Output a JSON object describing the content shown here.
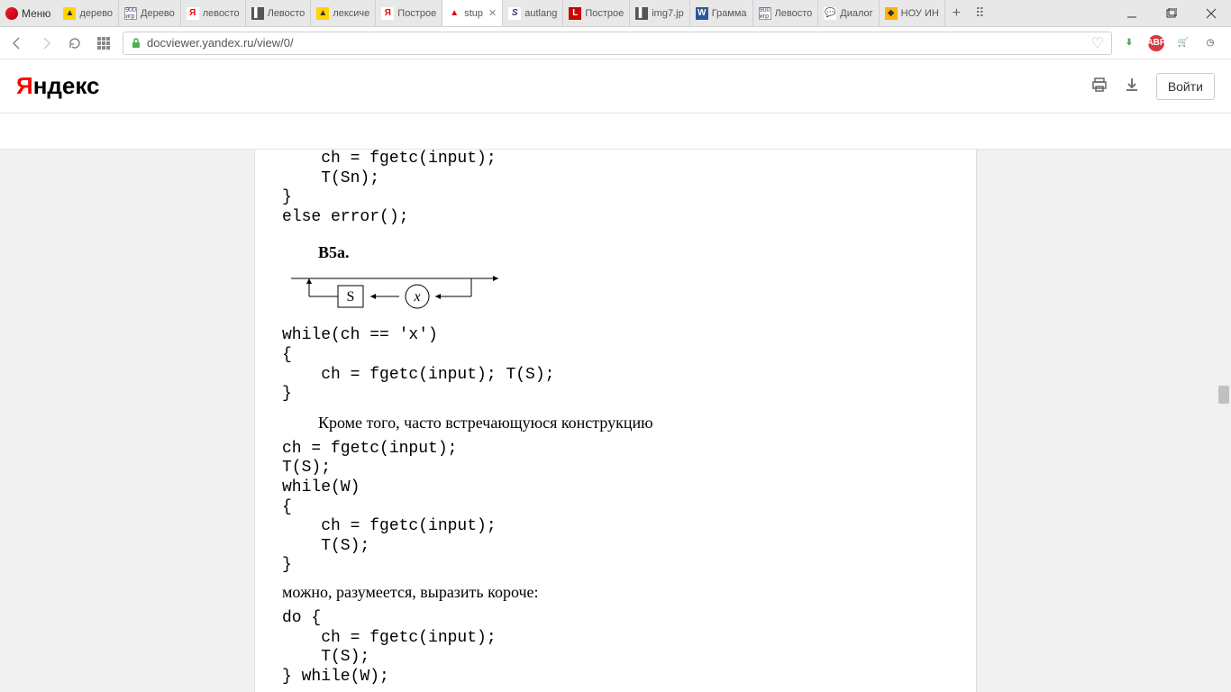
{
  "browser": {
    "menu_label": "Меню",
    "tabs": [
      {
        "label": "дерево"
      },
      {
        "label": "Дерево"
      },
      {
        "label": "левосто"
      },
      {
        "label": "Левосто"
      },
      {
        "label": "лексиче"
      },
      {
        "label": "Построе"
      },
      {
        "label": "stup"
      },
      {
        "label": "autlang"
      },
      {
        "label": "Построе"
      },
      {
        "label": "img7.jp"
      },
      {
        "label": "Грамма"
      },
      {
        "label": "Левосто"
      },
      {
        "label": "Диалог"
      },
      {
        "label": "НОУ ИН"
      }
    ],
    "active_tab_index": 6,
    "url": "docviewer.yandex.ru/view/0/"
  },
  "yandex": {
    "logo_first": "Я",
    "logo_rest": "ндекс",
    "login_label": "Войти"
  },
  "document": {
    "code1": "    ch = fgetc(input);\n    T(Sn);\n}\nelse error();",
    "section": "B5a.",
    "diagram": {
      "s": "S",
      "x": "x"
    },
    "code2": "while(ch == 'x')\n{\n    ch = fgetc(input); T(S);\n}",
    "para1": "Кроме того, часто встречающуюся конструкцию",
    "code3": "ch = fgetc(input);\nT(S);\nwhile(W)\n{\n    ch = fgetc(input);\n    T(S);\n}",
    "para2": "можно, разумеется, выразить короче:",
    "code4": "do {\n    ch = fgetc(input);\n    T(S);\n} while(W);"
  }
}
